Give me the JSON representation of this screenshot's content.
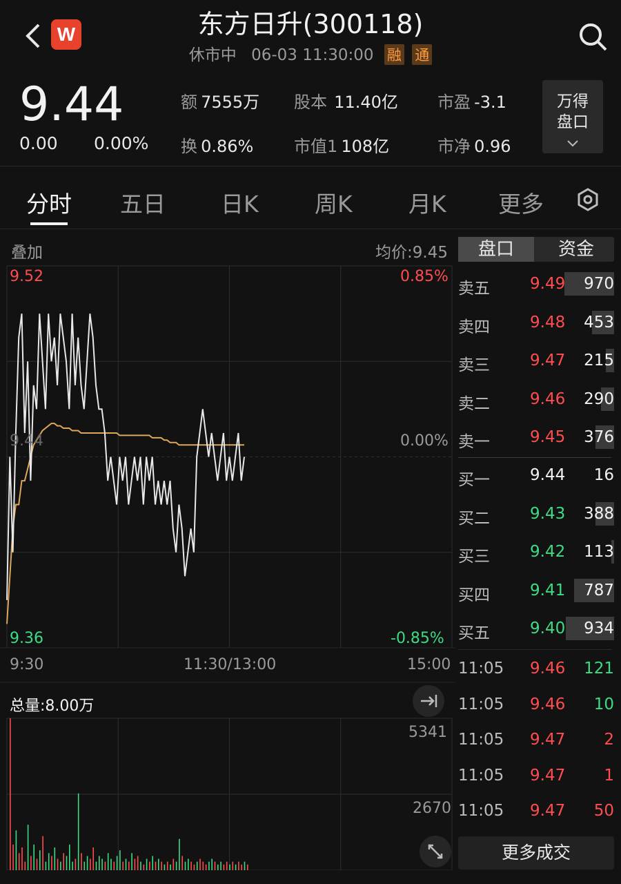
{
  "header": {
    "title": "东方日升(300118)",
    "status": "休市中",
    "datetime": "06-03 11:30:00",
    "tags": [
      "融",
      "通"
    ]
  },
  "quote": {
    "price": "9.44",
    "change": "0.00",
    "change_pct": "0.00%",
    "stats": [
      {
        "label": "额",
        "value": "7555万"
      },
      {
        "label": "股本",
        "value": "11.40亿"
      },
      {
        "label": "市盈",
        "value": "-3.1"
      },
      {
        "label": "换",
        "value": "0.86%"
      },
      {
        "label": "市值1",
        "value": "108亿"
      },
      {
        "label": "市净",
        "value": "0.96"
      }
    ],
    "wind_button": {
      "line1": "万得",
      "line2": "盘口"
    }
  },
  "tabs": [
    "分时",
    "五日",
    "日K",
    "周K",
    "月K",
    "更多"
  ],
  "chart": {
    "overlay_label": "叠加",
    "avg_label": "均价:9.45",
    "y_high": "9.52",
    "y_mid": "9.44",
    "y_low": "9.36",
    "pct_high": "0.85%",
    "pct_mid": "0.00%",
    "pct_low": "-0.85%",
    "x_labels": [
      "9:30",
      "11:30/13:00",
      "15:00"
    ],
    "volume_label": "总量:8.00万",
    "vol_high": "5341",
    "vol_mid": "2670"
  },
  "chart_data": {
    "type": "line",
    "ylim": [
      9.36,
      9.52
    ],
    "series": [
      {
        "name": "price",
        "values": [
          9.38,
          9.44,
          9.4,
          9.45,
          9.49,
          9.5,
          9.45,
          9.48,
          9.43,
          9.47,
          9.46,
          9.5,
          9.48,
          9.46,
          9.5,
          9.48,
          9.49,
          9.47,
          9.5,
          9.49,
          9.48,
          9.46,
          9.5,
          9.47,
          9.49,
          9.47,
          9.46,
          9.48,
          9.5,
          9.49,
          9.47,
          9.46,
          9.46,
          9.45,
          9.43,
          9.44,
          9.43,
          9.42,
          9.44,
          9.43,
          9.44,
          9.42,
          9.43,
          9.44,
          9.43,
          9.44,
          9.42,
          9.44,
          9.43,
          9.44,
          9.42,
          9.43,
          9.42,
          9.43,
          9.42,
          9.43,
          9.41,
          9.4,
          9.42,
          9.41,
          9.39,
          9.4,
          9.41,
          9.4,
          9.44,
          9.45,
          9.46,
          9.45,
          9.44,
          9.45,
          9.44,
          9.43,
          9.44,
          9.45,
          9.43,
          9.44,
          9.43,
          9.44,
          9.45,
          9.43,
          9.44
        ]
      },
      {
        "name": "avg",
        "values": [
          9.37,
          9.39,
          9.41,
          9.42,
          9.42,
          9.43,
          9.43,
          9.435,
          9.44,
          9.445,
          9.447,
          9.449,
          9.451,
          9.452,
          9.453,
          9.454,
          9.454,
          9.453,
          9.453,
          9.452,
          9.452,
          9.452,
          9.451,
          9.451,
          9.451,
          9.45,
          9.45,
          9.45,
          9.45,
          9.45,
          9.45,
          9.45,
          9.45,
          9.45,
          9.45,
          9.45,
          9.45,
          9.45,
          9.449,
          9.449,
          9.449,
          9.449,
          9.449,
          9.449,
          9.449,
          9.449,
          9.449,
          9.449,
          9.449,
          9.448,
          9.448,
          9.448,
          9.448,
          9.447,
          9.447,
          9.446,
          9.446,
          9.446,
          9.445,
          9.445,
          9.445,
          9.445,
          9.445,
          9.445,
          9.445,
          9.445,
          9.445,
          9.445,
          9.445,
          9.445,
          9.445,
          9.445,
          9.445,
          9.445,
          9.445,
          9.445,
          9.445,
          9.445,
          9.445,
          9.445,
          9.445
        ]
      }
    ],
    "volume": [
      5341,
      900,
      1400,
      600,
      800,
      300,
      1600,
      500,
      900,
      400,
      700,
      1200,
      300,
      600,
      500,
      800,
      400,
      300,
      600,
      500,
      900,
      300,
      400,
      2700,
      600,
      300,
      500,
      400,
      800,
      300,
      500,
      400,
      300,
      600,
      400,
      300,
      500,
      700,
      300,
      400,
      300,
      600,
      400,
      500,
      300,
      200,
      400,
      300,
      500,
      300,
      400,
      300,
      200,
      300,
      200,
      400,
      300,
      1100,
      500,
      300,
      400,
      300,
      200,
      300,
      400,
      300,
      200,
      300,
      400,
      300,
      200,
      300,
      200,
      300,
      200,
      300,
      200,
      300,
      200,
      300,
      200
    ]
  },
  "side_panel": {
    "tabs": [
      "盘口",
      "资金"
    ],
    "asks": [
      {
        "label": "卖五",
        "price": "9.49",
        "volume": "970",
        "level": 1.0
      },
      {
        "label": "卖四",
        "price": "9.48",
        "volume": "453",
        "level": 0.45
      },
      {
        "label": "卖三",
        "price": "9.47",
        "volume": "215",
        "level": 0.16
      },
      {
        "label": "卖二",
        "price": "9.46",
        "volume": "290",
        "level": 0.27
      },
      {
        "label": "卖一",
        "price": "9.45",
        "volume": "376",
        "level": 0.37
      }
    ],
    "bids": [
      {
        "label": "买一",
        "price": "9.44",
        "volume": "16",
        "level": 0.0
      },
      {
        "label": "买二",
        "price": "9.43",
        "volume": "388",
        "level": 0.38
      },
      {
        "label": "买三",
        "price": "9.42",
        "volume": "113",
        "level": 0.06
      },
      {
        "label": "买四",
        "price": "9.41",
        "volume": "787",
        "level": 0.8
      },
      {
        "label": "买五",
        "price": "9.40",
        "volume": "934",
        "level": 0.97
      }
    ],
    "trades": [
      {
        "time": "11:05",
        "price": "9.46",
        "volume": "121",
        "dir": "green"
      },
      {
        "time": "11:05",
        "price": "9.46",
        "volume": "10",
        "dir": "green"
      },
      {
        "time": "11:05",
        "price": "9.47",
        "volume": "2",
        "dir": "red"
      },
      {
        "time": "11:05",
        "price": "9.47",
        "volume": "1",
        "dir": "red"
      },
      {
        "time": "11:05",
        "price": "9.47",
        "volume": "50",
        "dir": "red"
      }
    ],
    "more_trades": "更多成交"
  }
}
